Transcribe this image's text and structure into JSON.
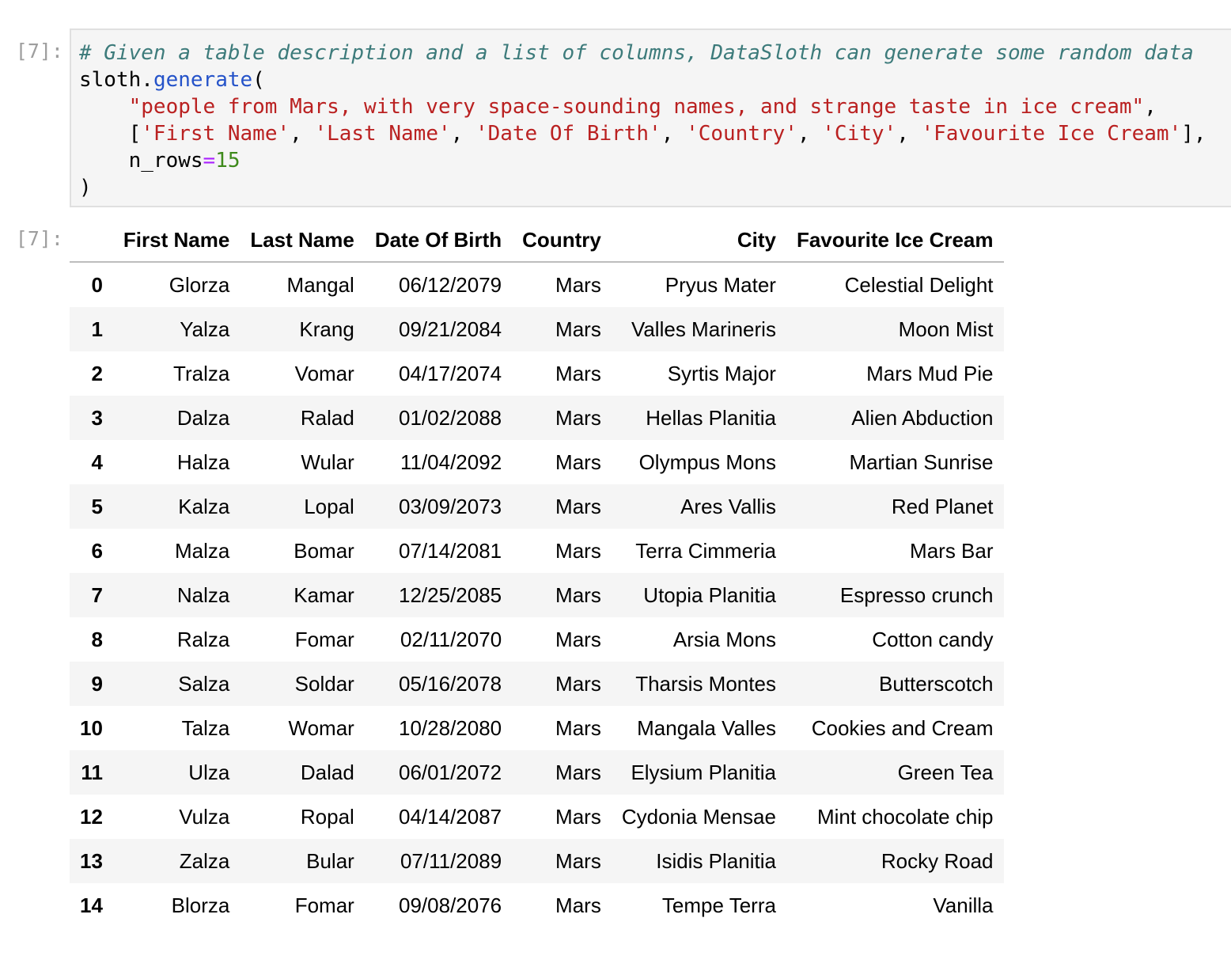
{
  "cell": {
    "input_prompt": "[7]:",
    "output_prompt": "[7]:"
  },
  "code": {
    "comment": "# Given a table description and a list of columns, DataSloth can generate some random data",
    "object": "sloth",
    "dot": ".",
    "function": "generate",
    "open_paren": "(",
    "indent": "    ",
    "description": "\"people from Mars, with very space-sounding names, and strange taste in ice cream\"",
    "comma": ",",
    "list_open": "[",
    "list_close": "]",
    "separator": ", ",
    "columns": [
      "'First Name'",
      "'Last Name'",
      "'Date Of Birth'",
      "'Country'",
      "'City'",
      "'Favourite Ice Cream'"
    ],
    "kwarg_name": "n_rows",
    "equals": "=",
    "kwarg_value": "15",
    "close_paren": ")"
  },
  "table": {
    "headers": [
      "",
      "First Name",
      "Last Name",
      "Date Of Birth",
      "Country",
      "City",
      "Favourite Ice Cream"
    ],
    "rows": [
      {
        "index": "0",
        "cells": [
          "Glorza",
          "Mangal",
          "06/12/2079",
          "Mars",
          "Pryus Mater",
          "Celestial Delight"
        ]
      },
      {
        "index": "1",
        "cells": [
          "Yalza",
          "Krang",
          "09/21/2084",
          "Mars",
          "Valles Marineris",
          "Moon Mist"
        ]
      },
      {
        "index": "2",
        "cells": [
          "Tralza",
          "Vomar",
          "04/17/2074",
          "Mars",
          "Syrtis Major",
          "Mars Mud Pie"
        ]
      },
      {
        "index": "3",
        "cells": [
          "Dalza",
          "Ralad",
          "01/02/2088",
          "Mars",
          "Hellas Planitia",
          "Alien Abduction"
        ]
      },
      {
        "index": "4",
        "cells": [
          "Halza",
          "Wular",
          "11/04/2092",
          "Mars",
          "Olympus Mons",
          "Martian Sunrise"
        ]
      },
      {
        "index": "5",
        "cells": [
          "Kalza",
          "Lopal",
          "03/09/2073",
          "Mars",
          "Ares Vallis",
          "Red Planet"
        ]
      },
      {
        "index": "6",
        "cells": [
          "Malza",
          "Bomar",
          "07/14/2081",
          "Mars",
          "Terra Cimmeria",
          "Mars Bar"
        ]
      },
      {
        "index": "7",
        "cells": [
          "Nalza",
          "Kamar",
          "12/25/2085",
          "Mars",
          "Utopia Planitia",
          "Espresso crunch"
        ]
      },
      {
        "index": "8",
        "cells": [
          "Ralza",
          "Fomar",
          "02/11/2070",
          "Mars",
          "Arsia Mons",
          "Cotton candy"
        ]
      },
      {
        "index": "9",
        "cells": [
          "Salza",
          "Soldar",
          "05/16/2078",
          "Mars",
          "Tharsis Montes",
          "Butterscotch"
        ]
      },
      {
        "index": "10",
        "cells": [
          "Talza",
          "Womar",
          "10/28/2080",
          "Mars",
          "Mangala Valles",
          "Cookies and Cream"
        ]
      },
      {
        "index": "11",
        "cells": [
          "Ulza",
          "Dalad",
          "06/01/2072",
          "Mars",
          "Elysium Planitia",
          "Green Tea"
        ]
      },
      {
        "index": "12",
        "cells": [
          "Vulza",
          "Ropal",
          "04/14/2087",
          "Mars",
          "Cydonia Mensae",
          "Mint chocolate chip"
        ]
      },
      {
        "index": "13",
        "cells": [
          "Zalza",
          "Bular",
          "07/11/2089",
          "Mars",
          "Isidis Planitia",
          "Rocky Road"
        ]
      },
      {
        "index": "14",
        "cells": [
          "Blorza",
          "Fomar",
          "09/08/2076",
          "Mars",
          "Tempe Terra",
          "Vanilla"
        ]
      }
    ]
  }
}
